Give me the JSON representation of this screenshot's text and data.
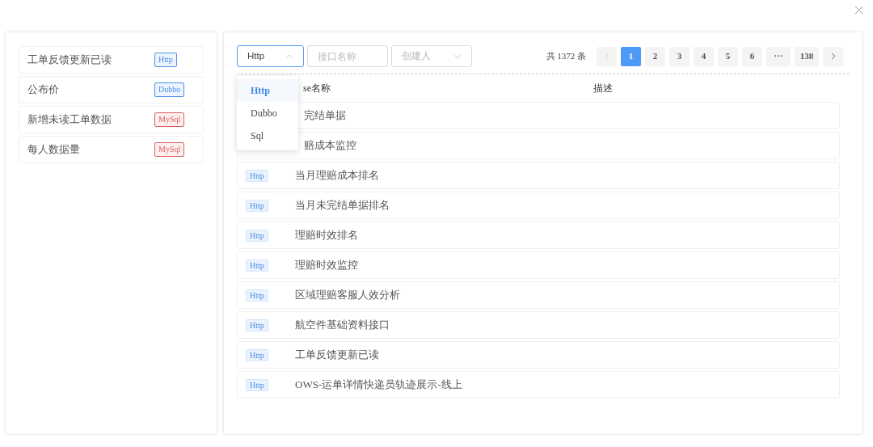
{
  "saved_list": [
    {
      "name": "工单反馈更新已读",
      "tag": "Http",
      "color": "#4a8fe8"
    },
    {
      "name": "公布价",
      "tag": "Dubbo",
      "color": "#4a8fe8"
    },
    {
      "name": "新增未读工单数据",
      "tag": "MySql",
      "color": "#e06060"
    },
    {
      "name": "每人数据量",
      "tag": "MySql",
      "color": "#e06060"
    }
  ],
  "toolbar": {
    "type_select": {
      "value": "Http",
      "expanded": true,
      "options": [
        {
          "label": "Http",
          "selected": true
        },
        {
          "label": "Dubbo",
          "selected": false
        },
        {
          "label": "Sql",
          "selected": false
        }
      ]
    },
    "name_field": {
      "placeholder": "接口名称"
    },
    "creator_select": {
      "placeholder": "创建人"
    }
  },
  "pagination": {
    "total": "共 1372 条",
    "prev_disabled": true,
    "next_disabled": false,
    "pages": [
      {
        "label": "1",
        "selected": true
      },
      {
        "label": "2",
        "selected": false
      },
      {
        "label": "3",
        "selected": false
      },
      {
        "label": "4",
        "selected": false
      },
      {
        "label": "5",
        "selected": false
      },
      {
        "label": "6",
        "selected": false
      },
      {
        "label": "···",
        "selected": false
      },
      {
        "label": "138",
        "selected": false
      }
    ]
  },
  "table": {
    "columns": [
      "se名称",
      "描述"
    ],
    "rows": [
      {
        "name": "完结单据"
      },
      {
        "name": "赔成本监控"
      },
      {
        "tag": "Http",
        "name": "当月理赔成本排名"
      },
      {
        "tag": "Http",
        "name": "当月未完结单据排名"
      },
      {
        "tag": "Http",
        "name": "理赔时效排名"
      },
      {
        "tag": "Http",
        "name": "理赔时效监控"
      },
      {
        "tag": "Http",
        "name": "区域理赔客服人效分析"
      },
      {
        "tag": "Http",
        "name": "航空件基础资料接口"
      },
      {
        "tag": "Http",
        "name": "工单反馈更新已读"
      },
      {
        "tag": "Http",
        "name": "OWS-运单详情快递员轨迹展示-线上"
      }
    ]
  }
}
